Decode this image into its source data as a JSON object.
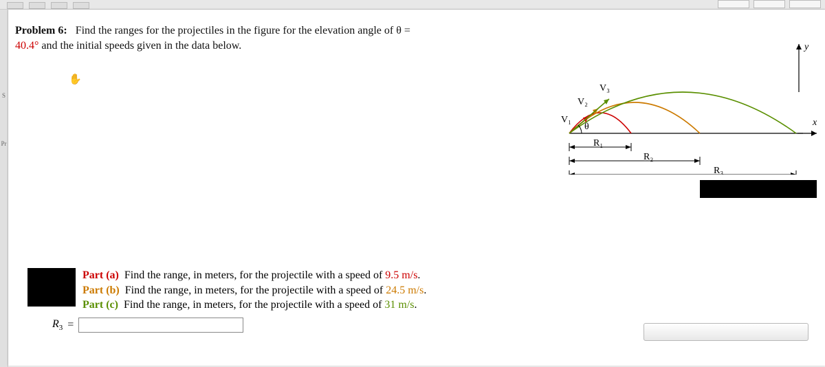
{
  "problem": {
    "label": "Problem 6:",
    "sentence_lead": "Find the ranges for the projectiles in the figure for the elevation angle of θ =",
    "angle": "40.4°",
    "sentence_tail": "and the initial speeds given in the data below."
  },
  "figure": {
    "v1": "V₁",
    "v2": "V₂",
    "v3": "V₃",
    "theta": "θ",
    "r1": "R₁",
    "r2": "R₂",
    "r3": "R₃",
    "y_axis": "y",
    "x_axis": "x"
  },
  "parts": {
    "a": {
      "label": "Part (a)",
      "text_pre": "Find the range, in meters, for the projectile with a speed of ",
      "value": "9.5 m/s",
      "text_post": "."
    },
    "b": {
      "label": "Part (b)",
      "text_pre": "Find the range, in meters, for the projectile with a speed of ",
      "value": "24.5 m/s",
      "text_post": "."
    },
    "c": {
      "label": "Part (c)",
      "text_pre": "Find the range, in meters, for the projectile with a speed of ",
      "value": "31 m/s",
      "text_post": "."
    }
  },
  "answer": {
    "lhs_sym": "R",
    "lhs_sub": "3",
    "equals": "=",
    "value": ""
  },
  "chart_data": {
    "type": "diagram",
    "description": "Three parabolic projectile trajectories from common origin at angle θ with increasing initial speeds V1<V2<V3 landing at ranges R1<R2<R3 along x-axis; y axis vertical.",
    "angle_label": "θ",
    "velocity_labels": [
      "V₁",
      "V₂",
      "V₃"
    ],
    "range_labels": [
      "R₁",
      "R₂",
      "R₃"
    ],
    "axes": {
      "x": "x",
      "y": "y"
    }
  }
}
